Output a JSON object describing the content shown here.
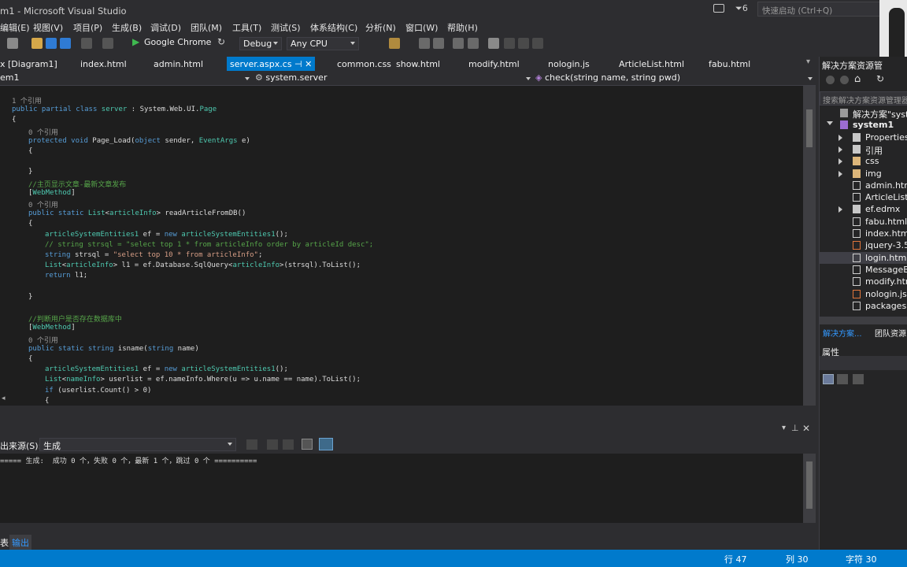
{
  "titlebar": {
    "title": "m1 - Microsoft Visual Studio",
    "filter_count": "6",
    "quick_launch_placeholder": "快速启动 (Ctrl+Q)"
  },
  "menu": [
    "编辑(E)",
    "视图(V)",
    "项目(P)",
    "生成(B)",
    "调试(D)",
    "团队(M)",
    "工具(T)",
    "测试(S)",
    "体系结构(C)",
    "分析(N)",
    "窗口(W)",
    "帮助(H)"
  ],
  "toolbar": {
    "browser": "Google Chrome",
    "config": "Debug",
    "platform": "Any CPU"
  },
  "tabs": [
    "x [Diagram1]",
    "index.html",
    "admin.html",
    "server.aspx.cs",
    "common.css",
    "show.html",
    "modify.html",
    "nologin.js",
    "ArticleList.html",
    "fabu.html"
  ],
  "active_tab": "server.aspx.cs",
  "navbar": {
    "project": "em1",
    "class": "system.server",
    "member": "check(string name, string pwd)"
  },
  "code": [
    {
      "ind": 0,
      "ref": "1 个引用"
    },
    {
      "ind": 0,
      "tokens": [
        [
          "kw",
          "public partial class "
        ],
        [
          "ty",
          "server"
        ],
        [
          "pl",
          " : System.Web.UI."
        ],
        [
          "ty",
          "Page"
        ]
      ]
    },
    {
      "ind": 0,
      "tokens": [
        [
          "pl",
          "{"
        ]
      ]
    },
    {
      "ind": 1,
      "ref": "0 个引用"
    },
    {
      "ind": 1,
      "tokens": [
        [
          "kw",
          "protected void "
        ],
        [
          "pl",
          "Page_Load("
        ],
        [
          "kw",
          "object "
        ],
        [
          "pl",
          "sender, "
        ],
        [
          "ty",
          "EventArgs "
        ],
        [
          "pl",
          "e)"
        ]
      ]
    },
    {
      "ind": 1,
      "tokens": [
        [
          "pl",
          "{"
        ]
      ]
    },
    {
      "ind": 1,
      "tokens": []
    },
    {
      "ind": 1,
      "tokens": [
        [
          "pl",
          "}"
        ]
      ]
    },
    {
      "ind": 1,
      "tokens": [
        [
          "cm",
          "//主页显示文章-最新文章发布"
        ]
      ]
    },
    {
      "ind": 1,
      "tokens": [
        [
          "pl",
          "["
        ],
        [
          "ty",
          "WebMethod"
        ],
        [
          "pl",
          "]"
        ]
      ]
    },
    {
      "ind": 1,
      "ref": "0 个引用"
    },
    {
      "ind": 1,
      "tokens": [
        [
          "kw",
          "public static "
        ],
        [
          "ty",
          "List"
        ],
        [
          "pl",
          "<"
        ],
        [
          "ty",
          "articleInfo"
        ],
        [
          "pl",
          "> readArticleFromDB()"
        ]
      ]
    },
    {
      "ind": 1,
      "tokens": [
        [
          "pl",
          "{"
        ]
      ]
    },
    {
      "ind": 2,
      "tokens": [
        [
          "ty",
          "articleSystemEntities1 "
        ],
        [
          "pl",
          "ef = "
        ],
        [
          "kw",
          "new "
        ],
        [
          "ty",
          "articleSystemEntities1"
        ],
        [
          "pl",
          "();"
        ]
      ]
    },
    {
      "ind": 2,
      "tokens": [
        [
          "cm",
          "// string strsql = \"select top 1 * from articleInfo order by articleId desc\";"
        ]
      ]
    },
    {
      "ind": 2,
      "tokens": [
        [
          "kw",
          "string "
        ],
        [
          "pl",
          "strsql = "
        ],
        [
          "st",
          "\"select top 10 * from articleInfo\""
        ],
        [
          "pl",
          ";"
        ]
      ]
    },
    {
      "ind": 2,
      "tokens": [
        [
          "ty",
          "List"
        ],
        [
          "pl",
          "<"
        ],
        [
          "ty",
          "articleInfo"
        ],
        [
          "pl",
          "> l1 = ef.Database.SqlQuery<"
        ],
        [
          "ty",
          "articleInfo"
        ],
        [
          "pl",
          ">(strsql).ToList();"
        ]
      ]
    },
    {
      "ind": 2,
      "tokens": [
        [
          "kw",
          "return "
        ],
        [
          "pl",
          "l1;"
        ]
      ]
    },
    {
      "ind": 1,
      "tokens": []
    },
    {
      "ind": 1,
      "tokens": [
        [
          "pl",
          "}"
        ]
      ]
    },
    {
      "ind": 1,
      "tokens": []
    },
    {
      "ind": 1,
      "tokens": [
        [
          "cm",
          "//判断用户是否存在数据库中"
        ]
      ]
    },
    {
      "ind": 1,
      "tokens": [
        [
          "pl",
          "["
        ],
        [
          "ty",
          "WebMethod"
        ],
        [
          "pl",
          "]"
        ]
      ]
    },
    {
      "ind": 1,
      "ref": "0 个引用"
    },
    {
      "ind": 1,
      "tokens": [
        [
          "kw",
          "public static string "
        ],
        [
          "pl",
          "isname("
        ],
        [
          "kw",
          "string "
        ],
        [
          "pl",
          "name)"
        ]
      ]
    },
    {
      "ind": 1,
      "tokens": [
        [
          "pl",
          "{"
        ]
      ]
    },
    {
      "ind": 2,
      "tokens": [
        [
          "ty",
          "articleSystemEntities1 "
        ],
        [
          "pl",
          "ef = "
        ],
        [
          "kw",
          "new "
        ],
        [
          "ty",
          "articleSystemEntities1"
        ],
        [
          "pl",
          "();"
        ]
      ]
    },
    {
      "ind": 2,
      "tokens": [
        [
          "ty",
          "List"
        ],
        [
          "pl",
          "<"
        ],
        [
          "ty",
          "nameInfo"
        ],
        [
          "pl",
          "> userlist = ef.nameInfo.Where(u => u.name == name).ToList();"
        ]
      ]
    },
    {
      "ind": 2,
      "tokens": [
        [
          "kw",
          "if "
        ],
        [
          "pl",
          "(userlist.Count() > 0)"
        ]
      ]
    },
    {
      "ind": 2,
      "tokens": [
        [
          "pl",
          "{"
        ]
      ]
    }
  ],
  "output": {
    "source_label": "出来源(S):",
    "source_value": "生成",
    "text": "===== 生成:  成功 0 个，失败 0 个，最新 1 个，跳过 0 个 =========="
  },
  "bottom_tabs": [
    "表",
    "输出"
  ],
  "solution_explorer": {
    "title": "解决方案资源管",
    "search_placeholder": "搜索解决方案资源管理器",
    "items": [
      {
        "label": "解决方案\"system1",
        "ind": 0,
        "icon": "solution",
        "arrow": ""
      },
      {
        "label": "system1",
        "ind": 0,
        "icon": "project",
        "arrow": "down",
        "bold": true
      },
      {
        "label": "Properties",
        "ind": 1,
        "icon": "wrench",
        "arrow": "right"
      },
      {
        "label": "引用",
        "ind": 1,
        "icon": "ref",
        "arrow": "right"
      },
      {
        "label": "css",
        "ind": 1,
        "icon": "folder",
        "arrow": "right"
      },
      {
        "label": "img",
        "ind": 1,
        "icon": "folder",
        "arrow": "right"
      },
      {
        "label": "admin.html",
        "ind": 1,
        "icon": "file",
        "arrow": ""
      },
      {
        "label": "ArticleList.h",
        "ind": 1,
        "icon": "file",
        "arrow": ""
      },
      {
        "label": "ef.edmx",
        "ind": 1,
        "icon": "edmx",
        "arrow": "right"
      },
      {
        "label": "fabu.html",
        "ind": 1,
        "icon": "file",
        "arrow": ""
      },
      {
        "label": "index.html",
        "ind": 1,
        "icon": "file",
        "arrow": ""
      },
      {
        "label": "jquery-3.5.",
        "ind": 1,
        "icon": "js",
        "arrow": ""
      },
      {
        "label": "login.html",
        "ind": 1,
        "icon": "file",
        "arrow": "",
        "selected": true
      },
      {
        "label": "MessageBo",
        "ind": 1,
        "icon": "file",
        "arrow": ""
      },
      {
        "label": "modify.htm",
        "ind": 1,
        "icon": "file",
        "arrow": ""
      },
      {
        "label": "nologin.js",
        "ind": 1,
        "icon": "js",
        "arrow": ""
      },
      {
        "label": "packages.c",
        "ind": 1,
        "icon": "config",
        "arrow": ""
      }
    ],
    "bottom_tabs": [
      "解决方案...",
      "团队资源..."
    ],
    "properties_title": "属性"
  },
  "status": {
    "line": "行 47",
    "col": "列 30",
    "ch": "字符 30"
  },
  "colors": {
    "accent": "#007acc",
    "bg": "#2d2d30",
    "editor": "#1e1e1e"
  }
}
